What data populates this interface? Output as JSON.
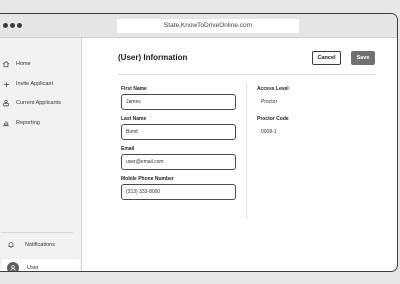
{
  "browser": {
    "url": "State.KnowToDriveOnline.com"
  },
  "sidebar": {
    "items": [
      {
        "label": "Home",
        "icon": "home-icon"
      },
      {
        "label": "Invite Applicant",
        "icon": "plus-icon"
      },
      {
        "label": "Current Applicants",
        "icon": "applicants-icon"
      },
      {
        "label": "Reporting",
        "icon": "bar-chart-icon"
      }
    ],
    "notifications_label": "Notifications",
    "user_label": "User"
  },
  "main": {
    "title": "(User) Information",
    "cancel_label": "Cancel",
    "save_label": "Save"
  },
  "form": {
    "first_name": {
      "label": "First Name",
      "value": "James"
    },
    "last_name": {
      "label": "Last Name",
      "value": "Bond"
    },
    "email": {
      "label": "Email",
      "value": "user@email.com"
    },
    "phone": {
      "label": "Mobile Phone Number",
      "value": "(313) 333-8000"
    }
  },
  "info": {
    "access_level": {
      "label": "Access Level",
      "value": "Proctor"
    },
    "proctor_code": {
      "label": "Proctor Code",
      "value": "0008-1"
    }
  }
}
